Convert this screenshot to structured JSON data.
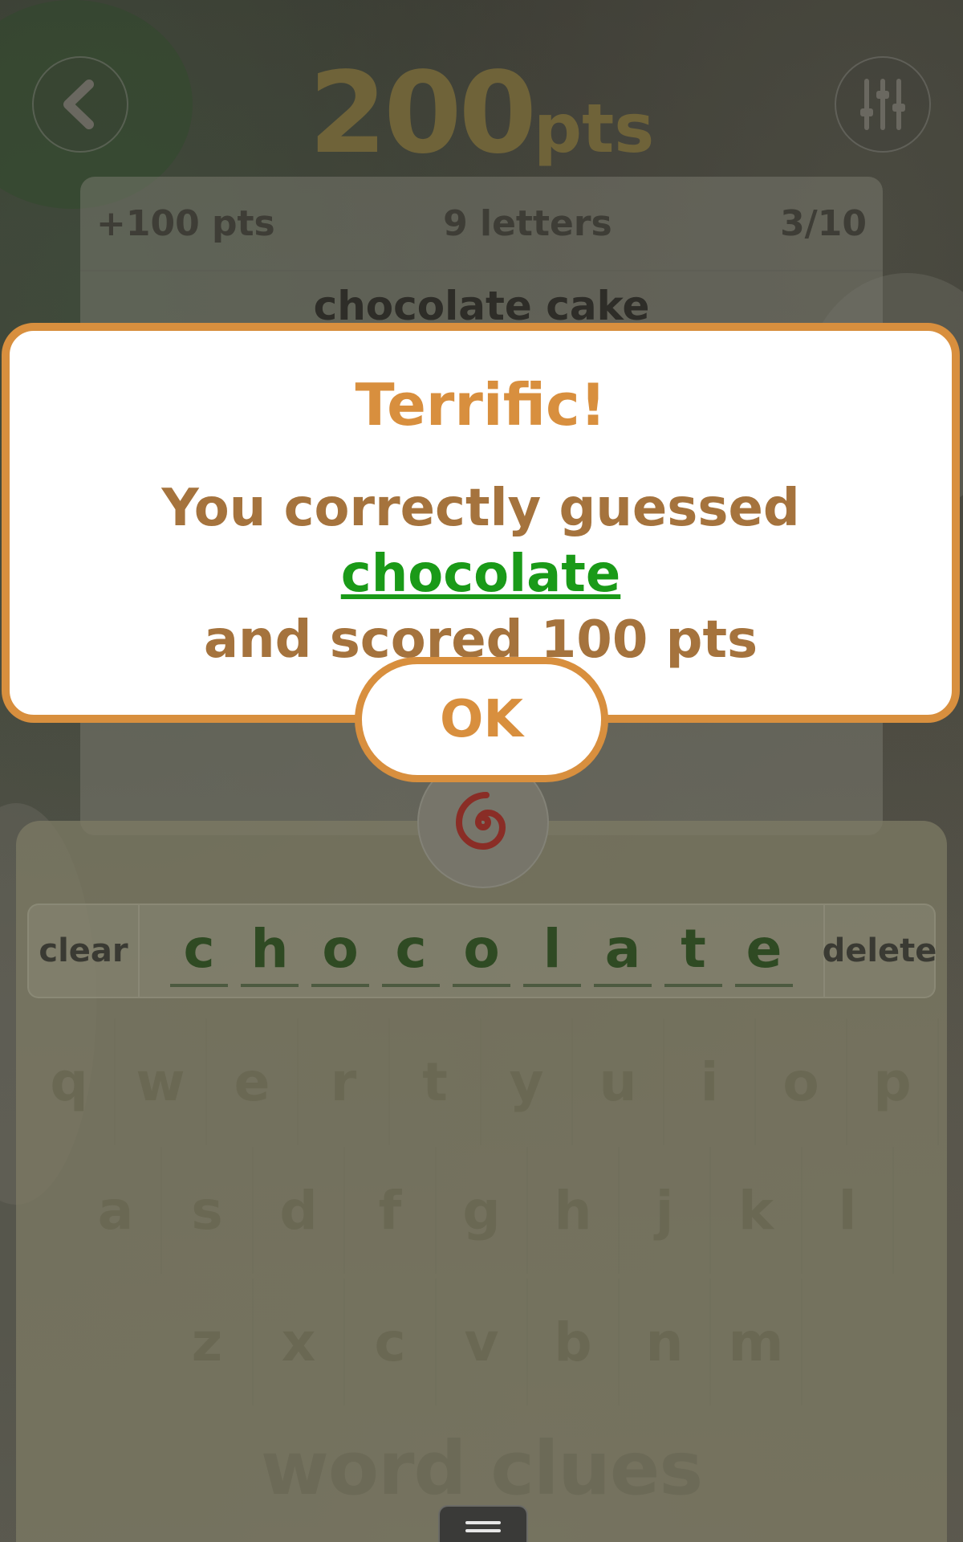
{
  "header": {
    "score_value": "200",
    "score_unit": "pts"
  },
  "card": {
    "points": "+100 pts",
    "letters": "9 letters",
    "progress": "3/10",
    "clue_partial": "chocolate cake"
  },
  "dialog": {
    "title": "Terrific!",
    "message_before": "You correctly guessed ",
    "guessed_word": "chocolate",
    "message_after": "and scored 100 pts",
    "ok_label": "OK"
  },
  "entry": {
    "clear_label": "clear",
    "delete_label": "delete",
    "letters": [
      "c",
      "h",
      "o",
      "c",
      "o",
      "l",
      "a",
      "t",
      "e"
    ]
  },
  "keyboard": {
    "row1": [
      "q",
      "w",
      "e",
      "r",
      "t",
      "y",
      "u",
      "i",
      "o",
      "p"
    ],
    "row2": [
      "a",
      "s",
      "d",
      "f",
      "g",
      "h",
      "j",
      "k",
      "l"
    ],
    "row3": [
      "z",
      "x",
      "c",
      "v",
      "b",
      "n",
      "m"
    ]
  },
  "footer": {
    "logo": "word clues"
  },
  "icons": {
    "back": "back-arrow-icon",
    "settings": "sliders-icon",
    "hint": "spiral-icon",
    "menu": "menu-icon"
  },
  "colors": {
    "accent": "#d88f3e",
    "message": "#a5733d",
    "correct_word": "#1a9a18",
    "entry_letters": "#2f4a23"
  }
}
